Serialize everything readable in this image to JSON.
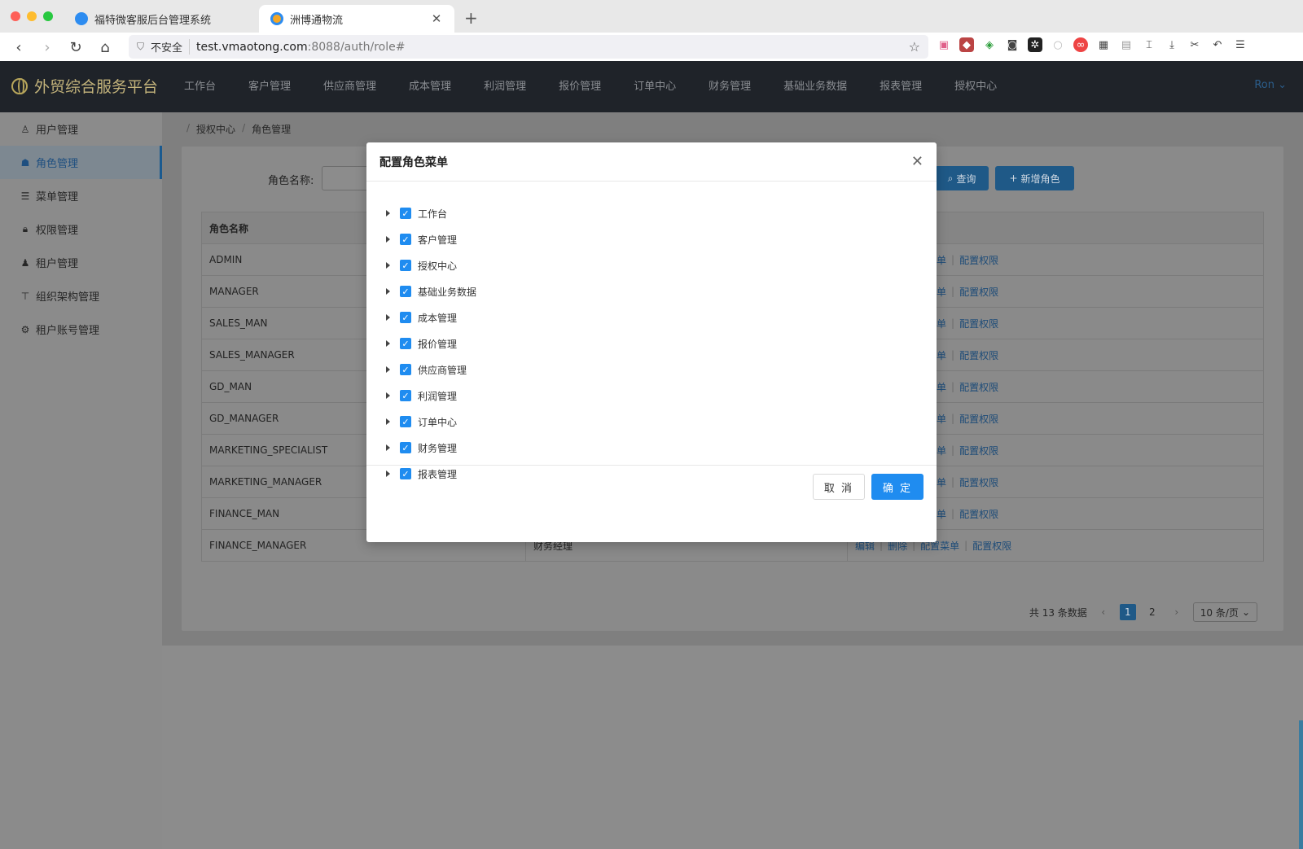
{
  "browser": {
    "tabs": [
      {
        "title": "福特微客服后台管理系统",
        "active": false
      },
      {
        "title": "洲博通物流",
        "active": true
      }
    ],
    "url": {
      "security": "不安全",
      "host": "test.vmaotong.com",
      "path": ":8088/auth/role#"
    },
    "nav_icons": [
      "back-icon",
      "forward-icon",
      "reload-icon",
      "home-icon"
    ]
  },
  "app": {
    "logo_text": "外贸综合服务平台",
    "top_menu": [
      "工作台",
      "客户管理",
      "供应商管理",
      "成本管理",
      "利润管理",
      "报价管理",
      "订单中心",
      "财务管理",
      "基础业务数据",
      "报表管理",
      "授权中心"
    ],
    "user": "Ron"
  },
  "sidebar": {
    "items": [
      {
        "label": "用户管理",
        "icon": "user-icon",
        "active": false
      },
      {
        "label": "角色管理",
        "icon": "role-icon",
        "active": true
      },
      {
        "label": "菜单管理",
        "icon": "menu-icon",
        "active": false
      },
      {
        "label": "权限管理",
        "icon": "lock-icon",
        "active": false
      },
      {
        "label": "租户管理",
        "icon": "tenant-icon",
        "active": false
      },
      {
        "label": "组织架构管理",
        "icon": "org-icon",
        "active": false
      },
      {
        "label": "租户账号管理",
        "icon": "account-icon",
        "active": false
      }
    ]
  },
  "page": {
    "breadcrumb": [
      "授权中心",
      "角色管理"
    ],
    "search_label": "角色名称:",
    "query_btn": "查询",
    "add_btn": "新增角色",
    "table": {
      "header": [
        "角色名称",
        "",
        ""
      ],
      "rows": [
        {
          "name": "ADMIN",
          "desc": ""
        },
        {
          "name": "MANAGER",
          "desc": ""
        },
        {
          "name": "SALES_MAN",
          "desc": ""
        },
        {
          "name": "SALES_MANAGER",
          "desc": ""
        },
        {
          "name": "GD_MAN",
          "desc": ""
        },
        {
          "name": "GD_MANAGER",
          "desc": ""
        },
        {
          "name": "MARKETING_SPECIALIST",
          "desc": ""
        },
        {
          "name": "MARKETING_MANAGER",
          "desc": ""
        },
        {
          "name": "FINANCE_MAN",
          "desc": ""
        },
        {
          "name": "FINANCE_MANAGER",
          "desc": "财务经理"
        }
      ],
      "partial_actions": [
        "菜单",
        "配置权限"
      ],
      "full_actions": [
        "编辑",
        "删除",
        "配置菜单",
        "配置权限"
      ]
    },
    "pagination": {
      "total": "共 13 条数据",
      "pages": [
        "1",
        "2"
      ],
      "current": "1",
      "page_size": "10 条/页"
    }
  },
  "modal": {
    "title": "配置角色菜单",
    "nodes": [
      {
        "label": "工作台",
        "checked": true
      },
      {
        "label": "客户管理",
        "checked": true
      },
      {
        "label": "授权中心",
        "checked": true
      },
      {
        "label": "基础业务数据",
        "checked": true
      },
      {
        "label": "成本管理",
        "checked": true
      },
      {
        "label": "报价管理",
        "checked": true
      },
      {
        "label": "供应商管理",
        "checked": true
      },
      {
        "label": "利润管理",
        "checked": true
      },
      {
        "label": "订单中心",
        "checked": true
      },
      {
        "label": "财务管理",
        "checked": true
      },
      {
        "label": "报表管理",
        "checked": true
      }
    ],
    "cancel": "取 消",
    "ok": "确 定"
  }
}
